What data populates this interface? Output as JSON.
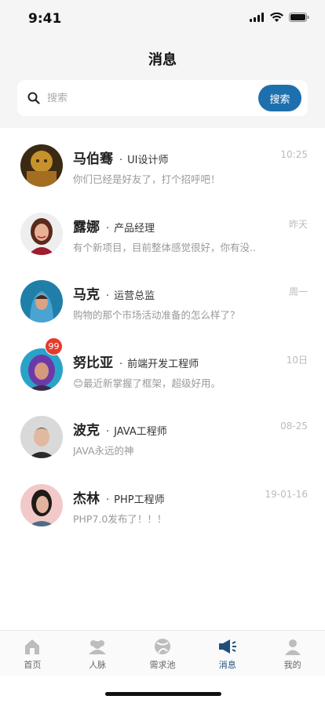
{
  "status_bar": {
    "time": "9:41"
  },
  "header": {
    "title": "消息"
  },
  "search": {
    "placeholder": "搜索",
    "button_label": "搜索"
  },
  "messages": [
    {
      "name": "马伯骞",
      "role": "UI设计师",
      "time": "10:25",
      "preview": "你们已经是好友了，打个招呼吧！",
      "badge": ""
    },
    {
      "name": "露娜",
      "role": "产品经理",
      "time": "昨天",
      "preview": "有个新项目，目前整体感觉很好，你有没..",
      "badge": ""
    },
    {
      "name": "马克",
      "role": "运营总监",
      "time": "周一",
      "preview": "购物的那个市场活动准备的怎么样了？",
      "badge": ""
    },
    {
      "name": "努比亚",
      "role": "前端开发工程师",
      "time": "10日",
      "preview": "😊最近新掌握了框架，超级好用。",
      "badge": "99"
    },
    {
      "name": "波克",
      "role": "JAVA工程师",
      "time": "08-25",
      "preview": "JAVA永远的神",
      "badge": ""
    },
    {
      "name": "杰林",
      "role": "PHP工程师",
      "time": "19-01-16",
      "preview": "PHP7.0发布了！！！",
      "badge": ""
    }
  ],
  "tabs": [
    {
      "label": "首页",
      "icon": "home-icon"
    },
    {
      "label": "人脉",
      "icon": "contacts-icon"
    },
    {
      "label": "需求池",
      "icon": "pool-icon"
    },
    {
      "label": "消息",
      "icon": "megaphone-icon",
      "active": true
    },
    {
      "label": "我的",
      "icon": "profile-icon"
    }
  ],
  "colors": {
    "accent": "#1e6fae",
    "active_tab": "#1e4f7a",
    "badge": "#e53b2c"
  }
}
